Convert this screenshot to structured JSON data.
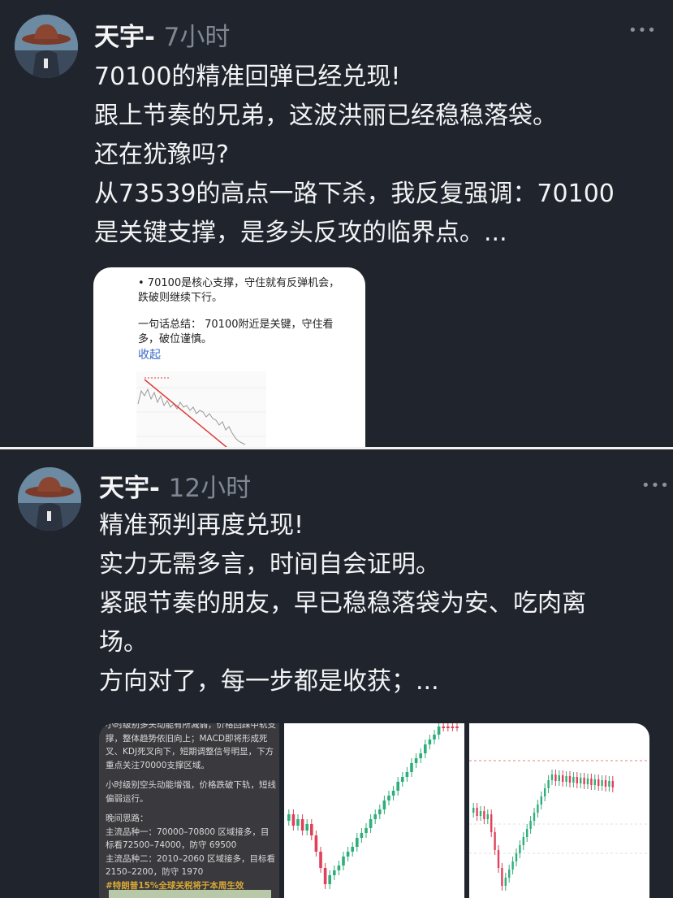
{
  "posts": [
    {
      "author": "天宇-",
      "time": "7小时",
      "more_icon": "•••",
      "lines": [
        "70100的精准回弹已经兑现!",
        "跟上节奏的兄弟，这波洪丽已经稳稳落袋。",
        "还在犹豫吗?",
        "从73539的高点一路下杀，我反复强调：70100",
        "是关键支撑，是多头反攻的临界点。..."
      ],
      "card": {
        "bullet": "• 70100是核心支撑，守住就有反弹机会，跌破则继续下行。",
        "summary": "一句话总结： 70100附近是关键，守住看多，破位谨慎。",
        "collapse": "收起"
      }
    },
    {
      "author": "天宇-",
      "time": "12小时",
      "more_icon": "•••",
      "lines": [
        "精准预判再度兑现!",
        "实力无需多言，时间自会证明。",
        "紧跟节奏的朋友，早已稳稳落袋为安、吃肉离",
        "场。",
        "方向对了，每一步都是收获；..."
      ],
      "image_text": {
        "para1": "小时级别多头动能有所减弱，价格回踩中轨支撑，整体趋势依旧向上；MACD即将形成死叉、KDJ死叉向下，短期调整信号明显，下方重点关注70000支撑区域。",
        "para2": "小时级别空头动能增强，价格跌破下轨，短线偏弱运行。",
        "para3_title": "晚间思路：",
        "para3_line1": "主流品种一：70000–70800 区域接多，目标看72500–74000，防守 69500",
        "para3_line2": "主流品种二：2010–2060 区域接多，目标看2150–2200，防守 1970",
        "highlight": "#特朗普15%全球关税将于本周生效"
      }
    }
  ],
  "colors": {
    "background": "#20242d",
    "time_gray": "#7f8792",
    "link_blue": "#3a68c7",
    "candle_up": "#2fae7a",
    "candle_down": "#e0405a",
    "trend_line": "#e03a3a"
  }
}
